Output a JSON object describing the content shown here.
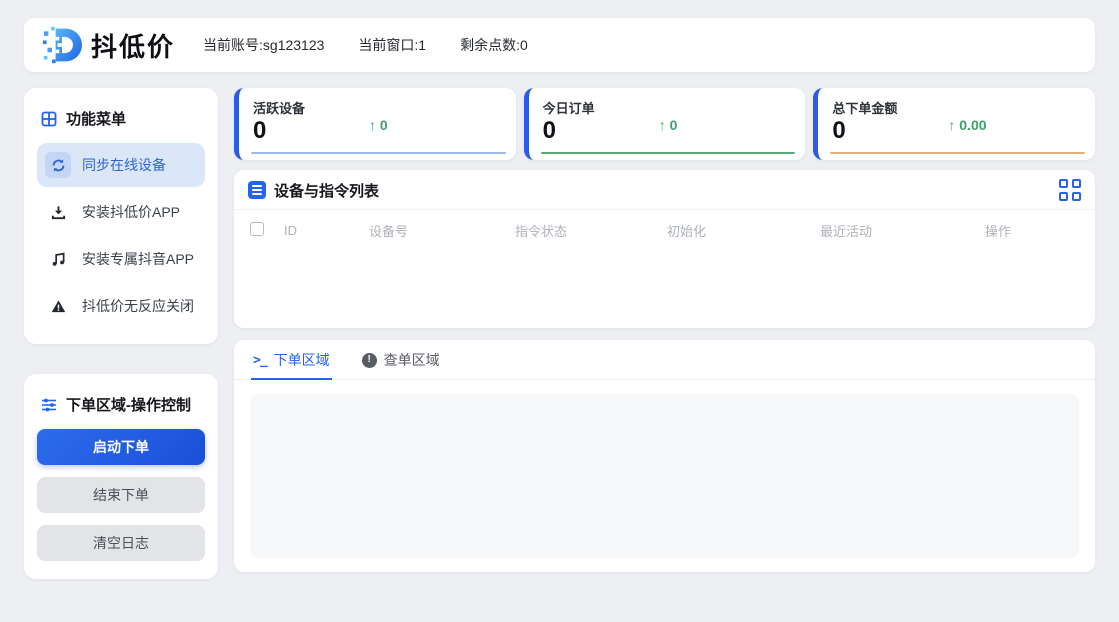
{
  "header": {
    "logo_text": "抖低价",
    "account": "当前账号:sg123123",
    "window": "当前窗口:1",
    "points": "剩余点数:0"
  },
  "sidebar": {
    "menu_title": "功能菜单",
    "items": [
      {
        "label": "同步在线设备",
        "icon": "sync-icon",
        "active": true
      },
      {
        "label": "安装抖低价APP",
        "icon": "download-icon",
        "active": false
      },
      {
        "label": "安装专属抖音APP",
        "icon": "music-note-icon",
        "active": false
      },
      {
        "label": "抖低价无反应关闭",
        "icon": "warning-icon",
        "active": false
      }
    ],
    "controls_title": "下单区域-操作控制",
    "start_button": "启动下单",
    "stop_button": "结束下单",
    "clear_button": "清空日志"
  },
  "stats": [
    {
      "title": "活跃设备",
      "value": "0",
      "delta": "↑ 0",
      "line_color": "#9cb8ea"
    },
    {
      "title": "今日订单",
      "value": "0",
      "delta": "↑ 0",
      "line_color": "#5aa878"
    },
    {
      "title": "总下单金额",
      "value": "0",
      "delta": "↑ 0.00",
      "line_color": "#e0b077"
    }
  ],
  "device_table": {
    "title": "设备与指令列表",
    "columns": {
      "id": "ID",
      "device": "设备号",
      "cmd_status": "指令状态",
      "init": "初始化",
      "last_active": "最近活动",
      "action": "操作"
    },
    "rows": []
  },
  "log_panel": {
    "order_tab": "下单区域",
    "query_tab": "查单区域"
  },
  "colors": {
    "primary_blue": "#2563eb",
    "active_item_bg": "#dbe6f9",
    "delta_green": "#3fa06a",
    "page_bg": "#edeff3"
  }
}
